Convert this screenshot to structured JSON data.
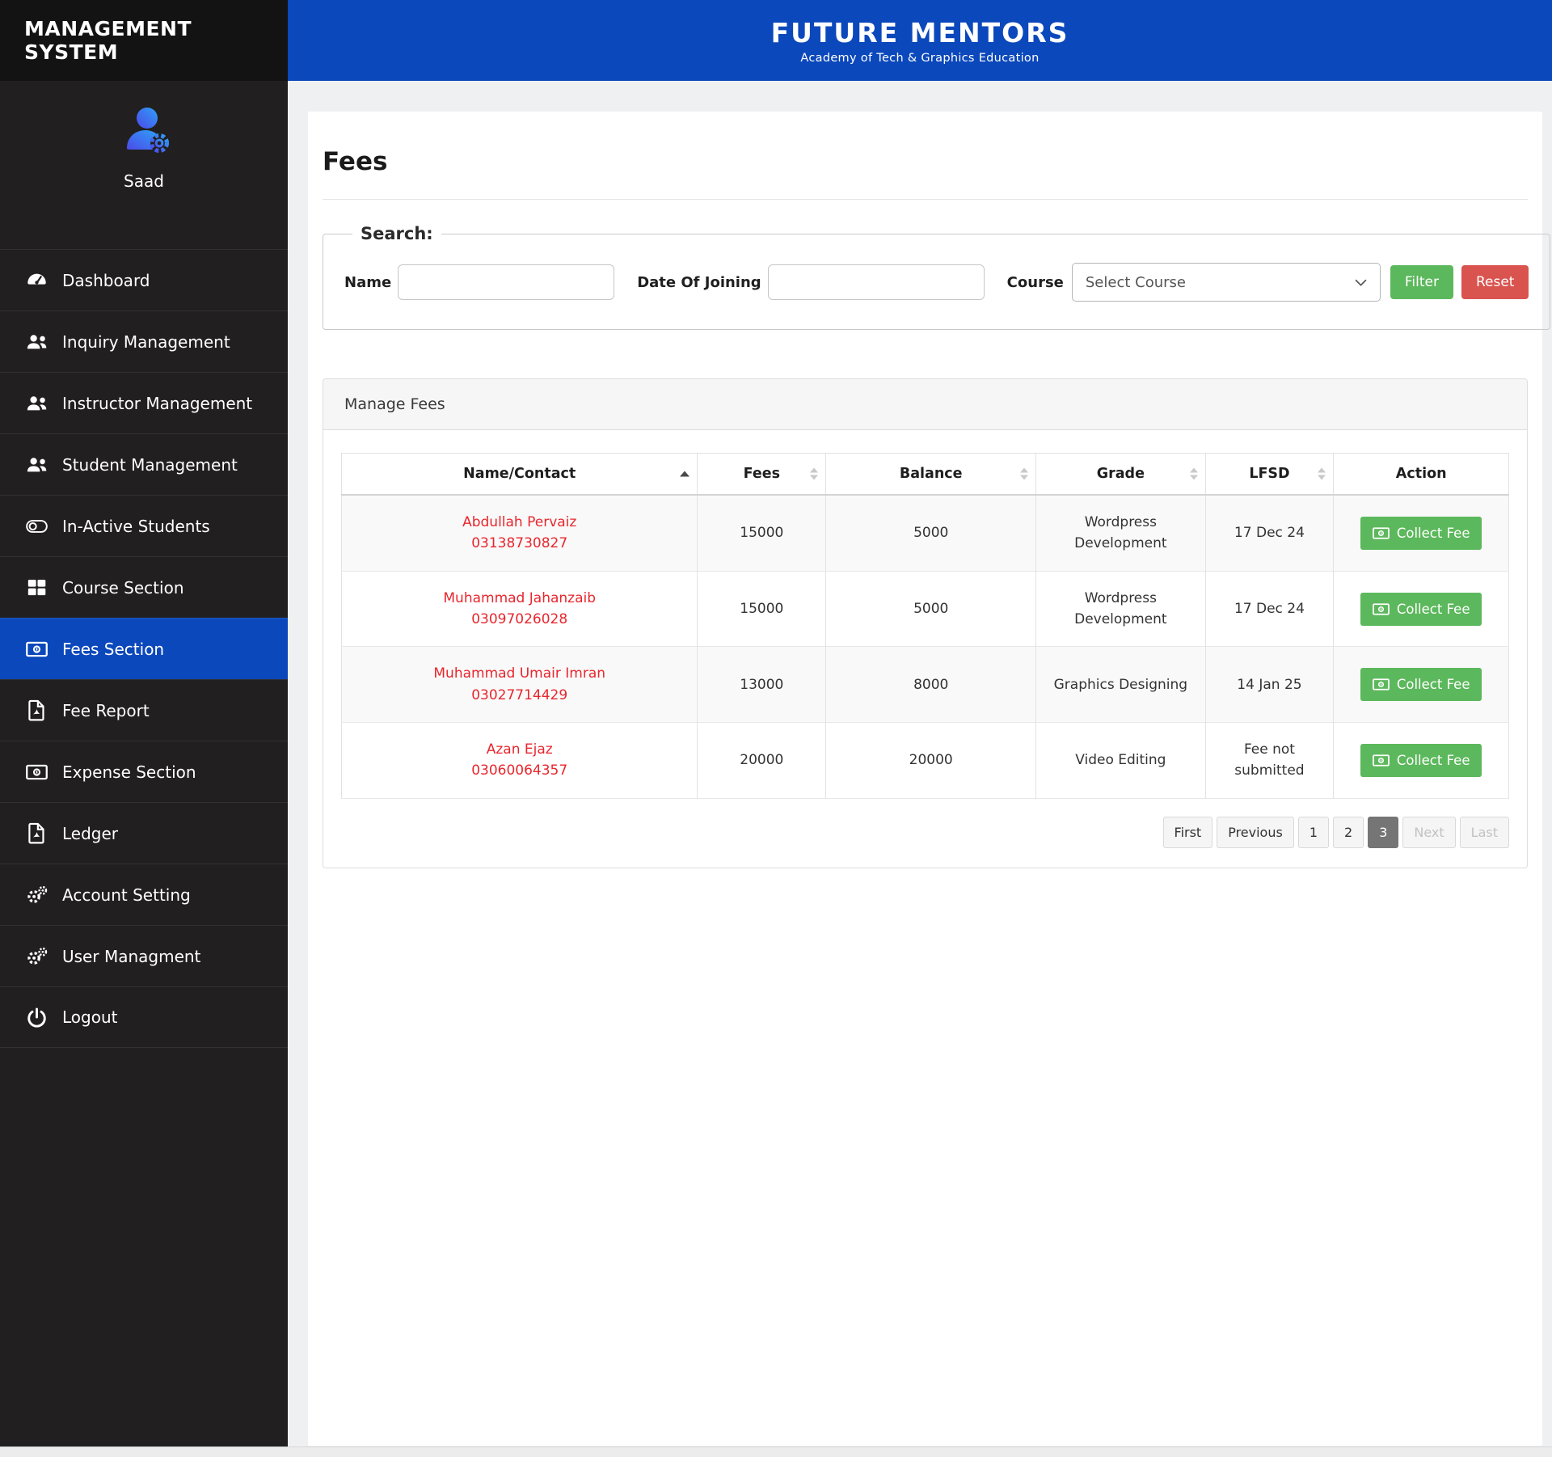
{
  "sidebar": {
    "title": "MANAGEMENT SYSTEM",
    "user_name": "Saad",
    "items": [
      {
        "label": "Dashboard",
        "icon": "dashboard-icon",
        "active": false
      },
      {
        "label": "Inquiry Management",
        "icon": "users-icon",
        "active": false
      },
      {
        "label": "Instructor Management",
        "icon": "users-icon",
        "active": false
      },
      {
        "label": "Student Management",
        "icon": "users-icon",
        "active": false
      },
      {
        "label": "In-Active Students",
        "icon": "toggle-off-icon",
        "active": false
      },
      {
        "label": "Course Section",
        "icon": "grid-icon",
        "active": false
      },
      {
        "label": "Fees Section",
        "icon": "money-bill-icon",
        "active": true
      },
      {
        "label": "Fee Report",
        "icon": "pdf-file-icon",
        "active": false
      },
      {
        "label": "Expense Section",
        "icon": "money-bill-icon",
        "active": false
      },
      {
        "label": "Ledger",
        "icon": "pdf-file-icon",
        "active": false
      },
      {
        "label": "Account Setting",
        "icon": "cogs-icon",
        "active": false
      },
      {
        "label": "User Managment",
        "icon": "cogs-icon",
        "active": false
      },
      {
        "label": "Logout",
        "icon": "power-icon",
        "active": false
      }
    ]
  },
  "header": {
    "brand": "FUTURE MENTORS",
    "tagline": "Academy of Tech & Graphics Education"
  },
  "page": {
    "title": "Fees"
  },
  "search": {
    "legend": "Search:",
    "name_label": "Name",
    "name_value": "",
    "doj_label": "Date Of Joining",
    "doj_value": "",
    "course_label": "Course",
    "course_selected": "Select Course",
    "filter_label": "Filter",
    "reset_label": "Reset"
  },
  "manage": {
    "title": "Manage Fees",
    "columns": [
      "Name/Contact",
      "Fees",
      "Balance",
      "Grade",
      "LFSD",
      "Action"
    ],
    "sorted_column": "Name/Contact",
    "sort_direction": "asc",
    "collect_label": "Collect Fee",
    "rows": [
      {
        "name": "Abdullah Pervaiz",
        "phone": "03138730827",
        "fees": "15000",
        "balance": "5000",
        "grade": "Wordpress Development",
        "lfsd": "17 Dec 24"
      },
      {
        "name": "Muhammad Jahanzaib",
        "phone": "03097026028",
        "fees": "15000",
        "balance": "5000",
        "grade": "Wordpress Development",
        "lfsd": "17 Dec 24"
      },
      {
        "name": "Muhammad Umair Imran",
        "phone": "03027714429",
        "fees": "13000",
        "balance": "8000",
        "grade": "Graphics Designing",
        "lfsd": "14 Jan 25"
      },
      {
        "name": "Azan Ejaz",
        "phone": "03060064357",
        "fees": "20000",
        "balance": "20000",
        "grade": "Video Editing",
        "lfsd": "Fee not submitted"
      }
    ],
    "pagination": {
      "first": "First",
      "previous": "Previous",
      "pages": [
        "1",
        "2",
        "3"
      ],
      "active_page": "3",
      "next": "Next",
      "last": "Last",
      "disabled": [
        "Next",
        "Last"
      ]
    }
  },
  "colors": {
    "header_blue": "#0b48bb",
    "active_item_blue": "#0b48bb",
    "sidebar_dark": "#211f1f",
    "sidebar_header_dark": "#141313",
    "name_red": "#e8262d",
    "filter_green": "#5cb85c",
    "reset_red": "#d9534f",
    "collect_green": "#5cb85c",
    "pagination_active_gray": "#757575"
  }
}
